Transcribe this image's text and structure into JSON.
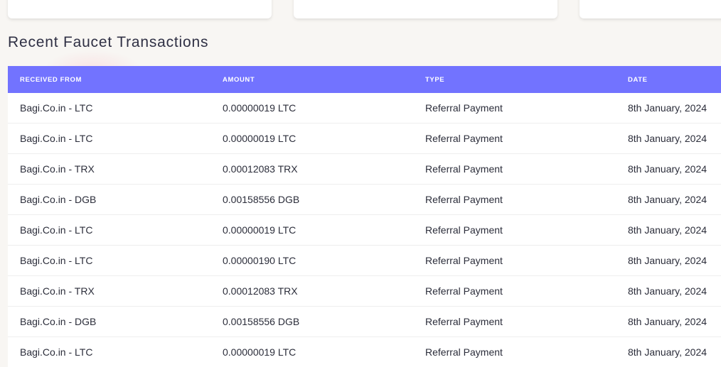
{
  "section": {
    "title": "Recent Faucet Transactions"
  },
  "table": {
    "headers": [
      "RECEIVED FROM",
      "AMOUNT",
      "TYPE",
      "DATE"
    ],
    "rows": [
      [
        "Bagi.Co.in - LTC",
        "0.00000019 LTC",
        "Referral Payment",
        "8th January, 2024"
      ],
      [
        "Bagi.Co.in - LTC",
        "0.00000019 LTC",
        "Referral Payment",
        "8th January, 2024"
      ],
      [
        "Bagi.Co.in - TRX",
        "0.00012083 TRX",
        "Referral Payment",
        "8th January, 2024"
      ],
      [
        "Bagi.Co.in - DGB",
        "0.00158556 DGB",
        "Referral Payment",
        "8th January, 2024"
      ],
      [
        "Bagi.Co.in - LTC",
        "0.00000019 LTC",
        "Referral Payment",
        "8th January, 2024"
      ],
      [
        "Bagi.Co.in - LTC",
        "0.00000190 LTC",
        "Referral Payment",
        "8th January, 2024"
      ],
      [
        "Bagi.Co.in - TRX",
        "0.00012083 TRX",
        "Referral Payment",
        "8th January, 2024"
      ],
      [
        "Bagi.Co.in - DGB",
        "0.00158556 DGB",
        "Referral Payment",
        "8th January, 2024"
      ],
      [
        "Bagi.Co.in - LTC",
        "0.00000019 LTC",
        "Referral Payment",
        "8th January, 2024"
      ]
    ]
  },
  "colors": {
    "header_bg": "#7273ff",
    "page_bg": "#f8f6f3",
    "text": "#2b2d3a"
  }
}
